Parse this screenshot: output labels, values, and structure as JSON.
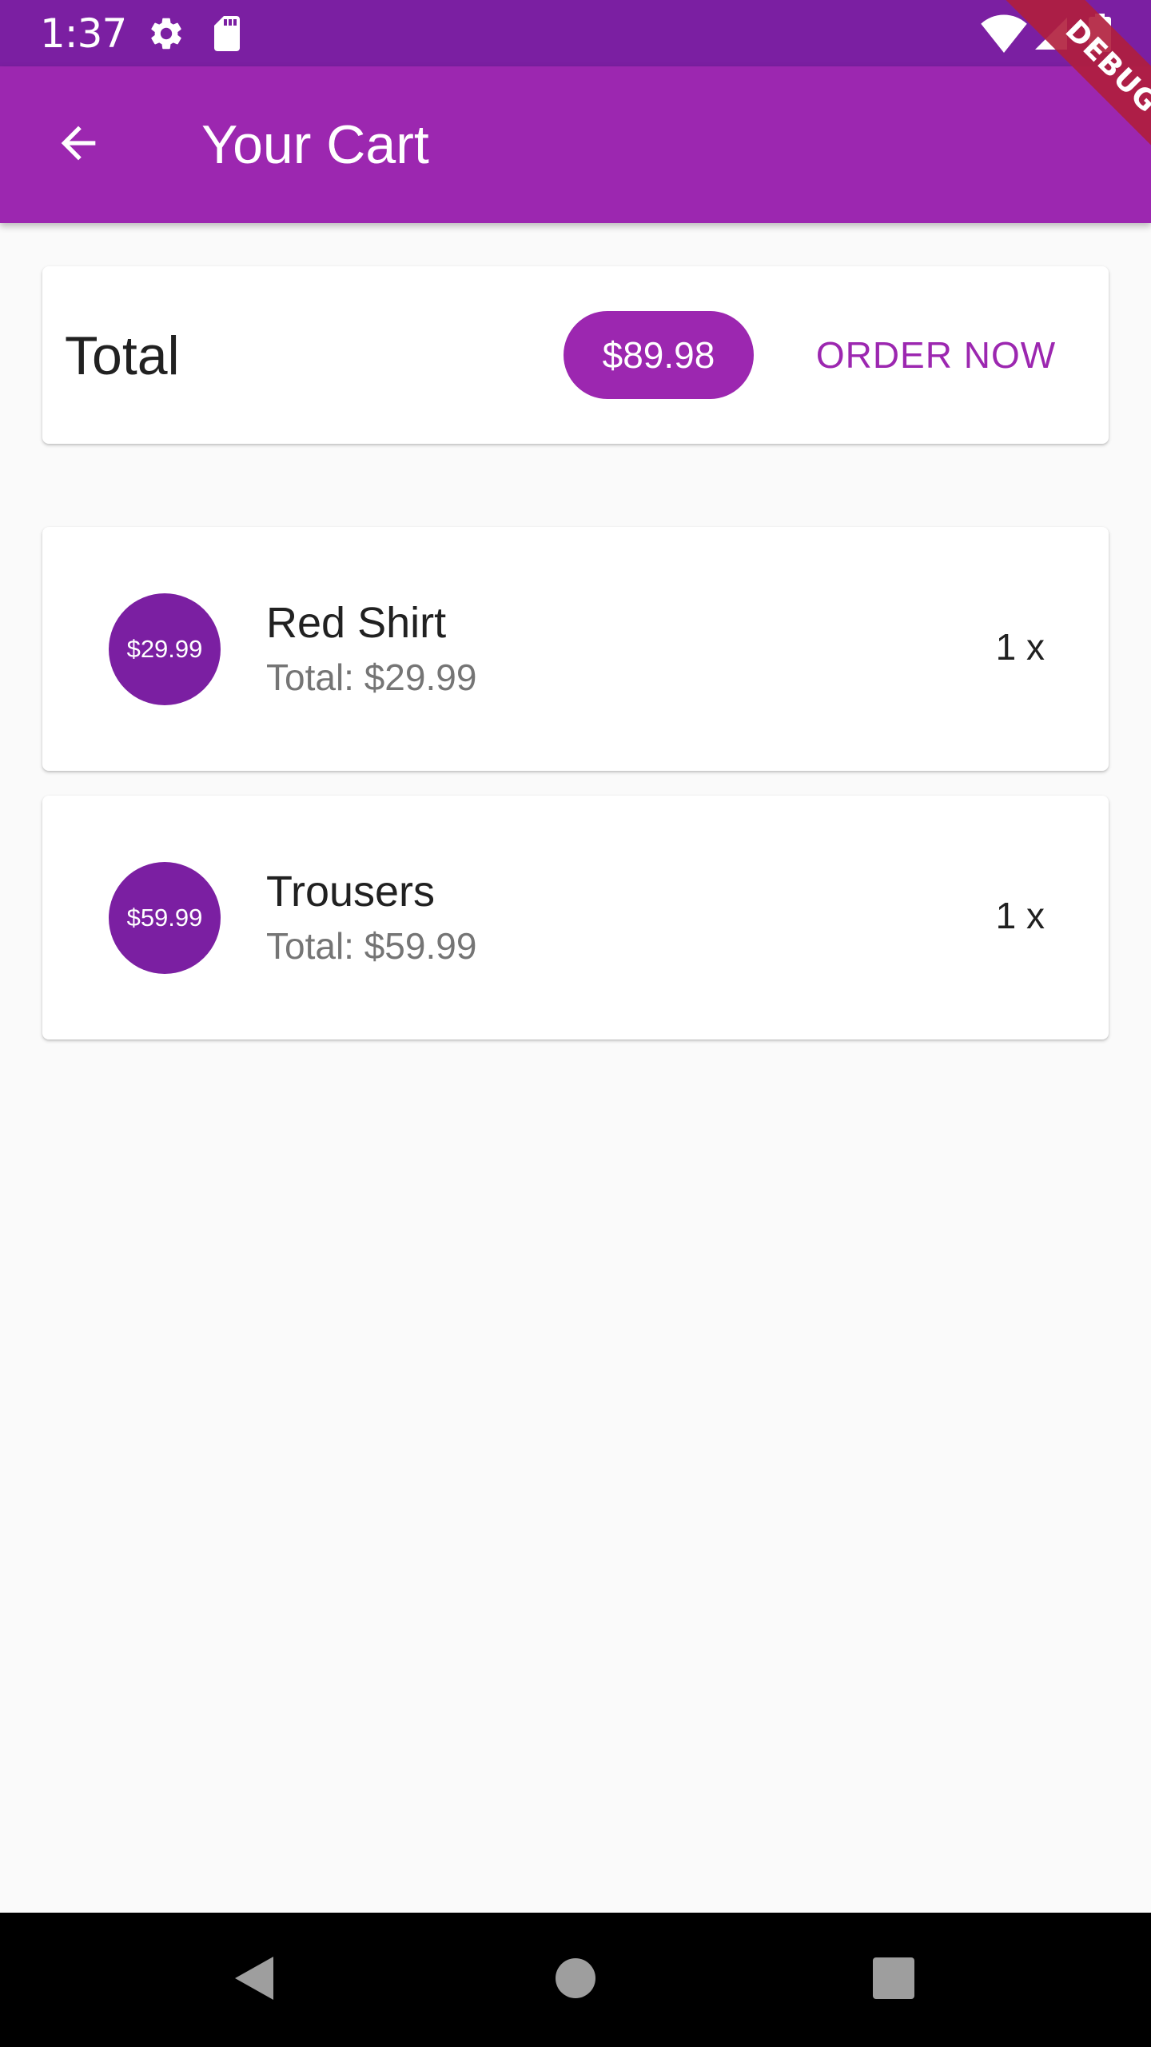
{
  "status_bar": {
    "time": "1:37",
    "left_icons": [
      "gear-icon",
      "sd-card-icon"
    ],
    "right_icons": [
      "wifi-icon",
      "signal-icon",
      "battery-icon"
    ]
  },
  "app_bar": {
    "title": "Your Cart",
    "back_icon": "arrow-back-icon",
    "color": "#9c27b0"
  },
  "debug_banner": "DEBUG",
  "summary": {
    "total_label": "Total",
    "total_amount": "$89.98",
    "order_button": "ORDER NOW"
  },
  "cart_items": [
    {
      "avatar_price": "$29.99",
      "title": "Red Shirt",
      "subtitle": "Total: $29.99",
      "quantity": "1 x"
    },
    {
      "avatar_price": "$59.99",
      "title": "Trousers",
      "subtitle": "Total: $59.99",
      "quantity": "1 x"
    }
  ],
  "nav_bar": {
    "buttons": [
      "back-triangle-icon",
      "home-circle-icon",
      "recents-square-icon"
    ]
  },
  "colors": {
    "primary": "#9c27b0",
    "primary_dark": "#7b1fa2",
    "background": "#fafafa"
  }
}
